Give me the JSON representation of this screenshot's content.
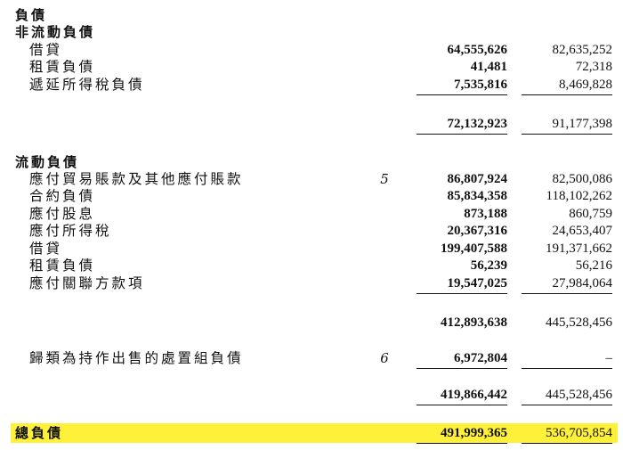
{
  "heading": "負債",
  "non_current": {
    "title": "非流動負債",
    "rows": [
      {
        "label": "借貸",
        "v1": "64,555,626",
        "v2": "82,635,252"
      },
      {
        "label": "租賃負債",
        "v1": "41,481",
        "v2": "72,318"
      },
      {
        "label": "遞延所得稅負債",
        "v1": "7,535,816",
        "v2": "8,469,828"
      }
    ],
    "subtotal": {
      "v1": "72,132,923",
      "v2": "91,177,398"
    }
  },
  "current": {
    "title": "流動負債",
    "rows": [
      {
        "label": "應付貿易賬款及其他應付賬款",
        "note": "5",
        "v1": "86,807,924",
        "v2": "82,500,086"
      },
      {
        "label": "合約負債",
        "v1": "85,834,358",
        "v2": "118,102,262"
      },
      {
        "label": "應付股息",
        "v1": "873,188",
        "v2": "860,759"
      },
      {
        "label": "應付所得稅",
        "v1": "20,367,316",
        "v2": "24,653,407"
      },
      {
        "label": "借貸",
        "v1": "199,407,588",
        "v2": "191,371,662"
      },
      {
        "label": "租賃負債",
        "v1": "56,239",
        "v2": "56,216"
      },
      {
        "label": "應付關聯方款項",
        "v1": "19,547,025",
        "v2": "27,984,064"
      }
    ],
    "subtotal": {
      "v1": "412,893,638",
      "v2": "445,528,456"
    },
    "held_for_sale": {
      "label": "歸類為持作出售的處置組負債",
      "note": "6",
      "v1": "6,972,804",
      "v2": "–"
    },
    "total": {
      "v1": "419,866,442",
      "v2": "445,528,456"
    }
  },
  "grand_total": {
    "label": "總負債",
    "v1": "491,999,365",
    "v2": "536,705,854"
  },
  "colors": {
    "highlight": "#fff13a",
    "text": "#111111"
  }
}
